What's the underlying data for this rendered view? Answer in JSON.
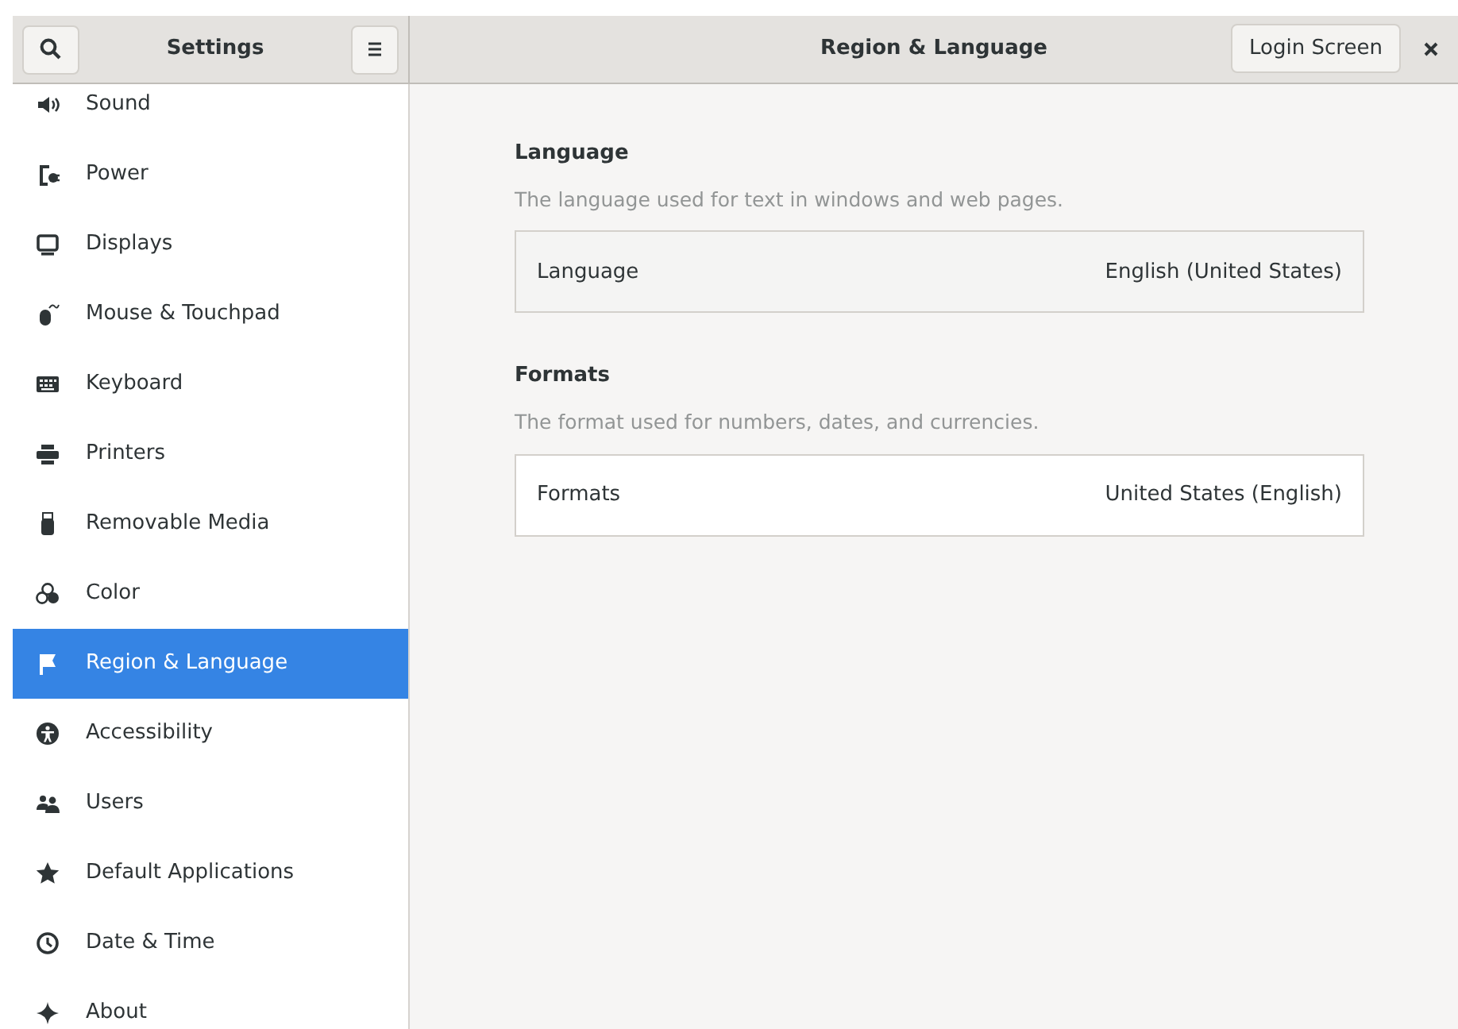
{
  "sidebar": {
    "title": "Settings",
    "items": [
      {
        "label": "Sound",
        "selected": false
      },
      {
        "label": "Power",
        "selected": false
      },
      {
        "label": "Displays",
        "selected": false
      },
      {
        "label": "Mouse & Touchpad",
        "selected": false
      },
      {
        "label": "Keyboard",
        "selected": false
      },
      {
        "label": "Printers",
        "selected": false
      },
      {
        "label": "Removable Media",
        "selected": false
      },
      {
        "label": "Color",
        "selected": false
      },
      {
        "label": "Region & Language",
        "selected": true
      },
      {
        "label": "Accessibility",
        "selected": false
      },
      {
        "label": "Users",
        "selected": false
      },
      {
        "label": "Default Applications",
        "selected": false
      },
      {
        "label": "Date & Time",
        "selected": false
      },
      {
        "label": "About",
        "selected": false
      }
    ]
  },
  "header": {
    "title": "Region & Language",
    "button": "Login Screen"
  },
  "sections": [
    {
      "heading": "Language",
      "description": "The language used for text in windows and web pages.",
      "row": {
        "label": "Language",
        "value": "English (United States)",
        "highlighted": true
      }
    },
    {
      "heading": "Formats",
      "description": "The format used for numbers, dates, and currencies.",
      "row": {
        "label": "Formats",
        "value": "United States (English)",
        "highlighted": false
      }
    }
  ]
}
